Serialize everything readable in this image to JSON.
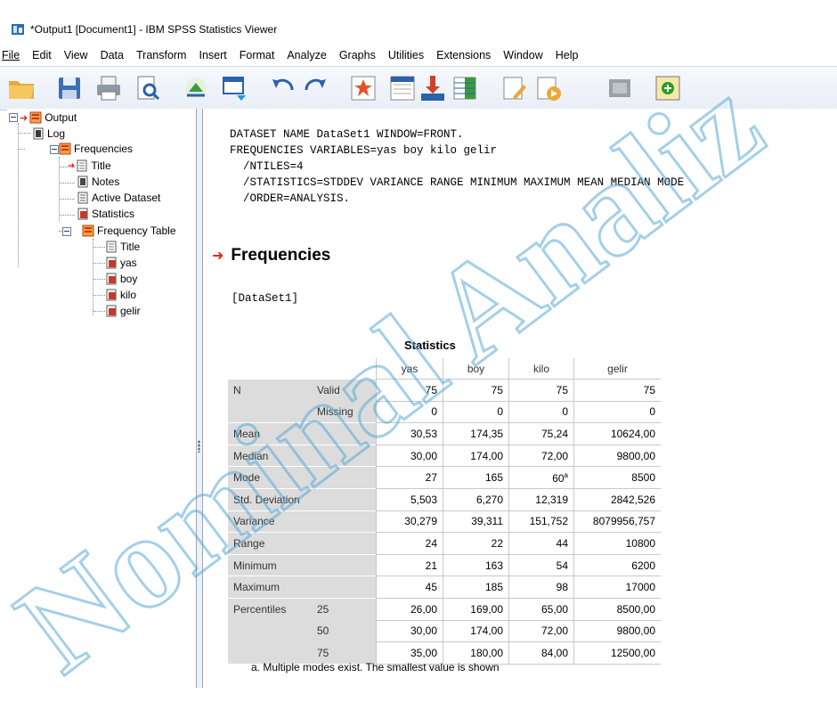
{
  "window": {
    "title": "*Output1 [Document1] - IBM SPSS Statistics Viewer"
  },
  "menu": [
    "File",
    "Edit",
    "View",
    "Data",
    "Transform",
    "Insert",
    "Format",
    "Analyze",
    "Graphs",
    "Utilities",
    "Extensions",
    "Window",
    "Help"
  ],
  "toolbar": {
    "icons": [
      "open-icon",
      "save-icon",
      "print-icon",
      "print-preview-icon",
      "export-icon",
      "recall-dialog-icon",
      "undo-icon",
      "redo-icon",
      "goto-data-icon",
      "goto-case-icon",
      "goto-variable-icon",
      "variables-icon",
      "designate-window-icon",
      "run-icon",
      "disabled-icon",
      "insert-output-icon"
    ]
  },
  "tree": {
    "output": "Output",
    "log": "Log",
    "frequencies": "Frequencies",
    "title": "Title",
    "notes": "Notes",
    "active_dataset": "Active Dataset",
    "statistics": "Statistics",
    "frequency_table": "Frequency Table",
    "ft_title": "Title",
    "yas": "yas",
    "boy": "boy",
    "kilo": "kilo",
    "gelir": "gelir"
  },
  "syntax": {
    "line1": "DATASET NAME DataSet1 WINDOW=FRONT.",
    "line2": "FREQUENCIES VARIABLES=yas boy kilo gelir",
    "line3": "  /NTILES=4",
    "line4": "  /STATISTICS=STDDEV VARIANCE RANGE MINIMUM MAXIMUM MEAN MEDIAN MODE",
    "line5": "  /ORDER=ANALYSIS."
  },
  "heading": "Frequencies",
  "dataset_label": "[DataSet1]",
  "stats": {
    "title": "Statistics",
    "columns": [
      "yas",
      "boy",
      "kilo",
      "gelir"
    ],
    "rows": [
      {
        "l1": "N",
        "l2": "Valid",
        "v": [
          "75",
          "75",
          "75",
          "75"
        ]
      },
      {
        "l1": "",
        "l2": "Missing",
        "v": [
          "0",
          "0",
          "0",
          "0"
        ]
      },
      {
        "l1": "Mean",
        "l2": "",
        "v": [
          "30,53",
          "174,35",
          "75,24",
          "10624,00"
        ]
      },
      {
        "l1": "Median",
        "l2": "",
        "v": [
          "30,00",
          "174,00",
          "72,00",
          "9800,00"
        ]
      },
      {
        "l1": "Mode",
        "l2": "",
        "v": [
          "27",
          "165",
          "60",
          "8500"
        ]
      },
      {
        "l1": "Std. Deviation",
        "l2": "",
        "v": [
          "5,503",
          "6,270",
          "12,319",
          "2842,526"
        ]
      },
      {
        "l1": "Variance",
        "l2": "",
        "v": [
          "30,279",
          "39,311",
          "151,752",
          "8079956,757"
        ]
      },
      {
        "l1": "Range",
        "l2": "",
        "v": [
          "24",
          "22",
          "44",
          "10800"
        ]
      },
      {
        "l1": "Minimum",
        "l2": "",
        "v": [
          "21",
          "163",
          "54",
          "6200"
        ]
      },
      {
        "l1": "Maximum",
        "l2": "",
        "v": [
          "45",
          "185",
          "98",
          "17000"
        ]
      },
      {
        "l1": "Percentiles",
        "l2": "25",
        "v": [
          "26,00",
          "169,00",
          "65,00",
          "8500,00"
        ]
      },
      {
        "l1": "",
        "l2": "50",
        "v": [
          "30,00",
          "174,00",
          "72,00",
          "9800,00"
        ]
      },
      {
        "l1": "",
        "l2": "75",
        "v": [
          "35,00",
          "180,00",
          "84,00",
          "12500,00"
        ]
      }
    ],
    "mode_superscript": "a",
    "footnote": "a. Multiple modes exist. The smallest value is shown"
  },
  "watermark": {
    "text": "Nominal Analiz",
    "color": "#5aa9d6"
  },
  "colors": {
    "accent_arrow": "#e4251b",
    "label_bg": "#dcdcdc"
  }
}
